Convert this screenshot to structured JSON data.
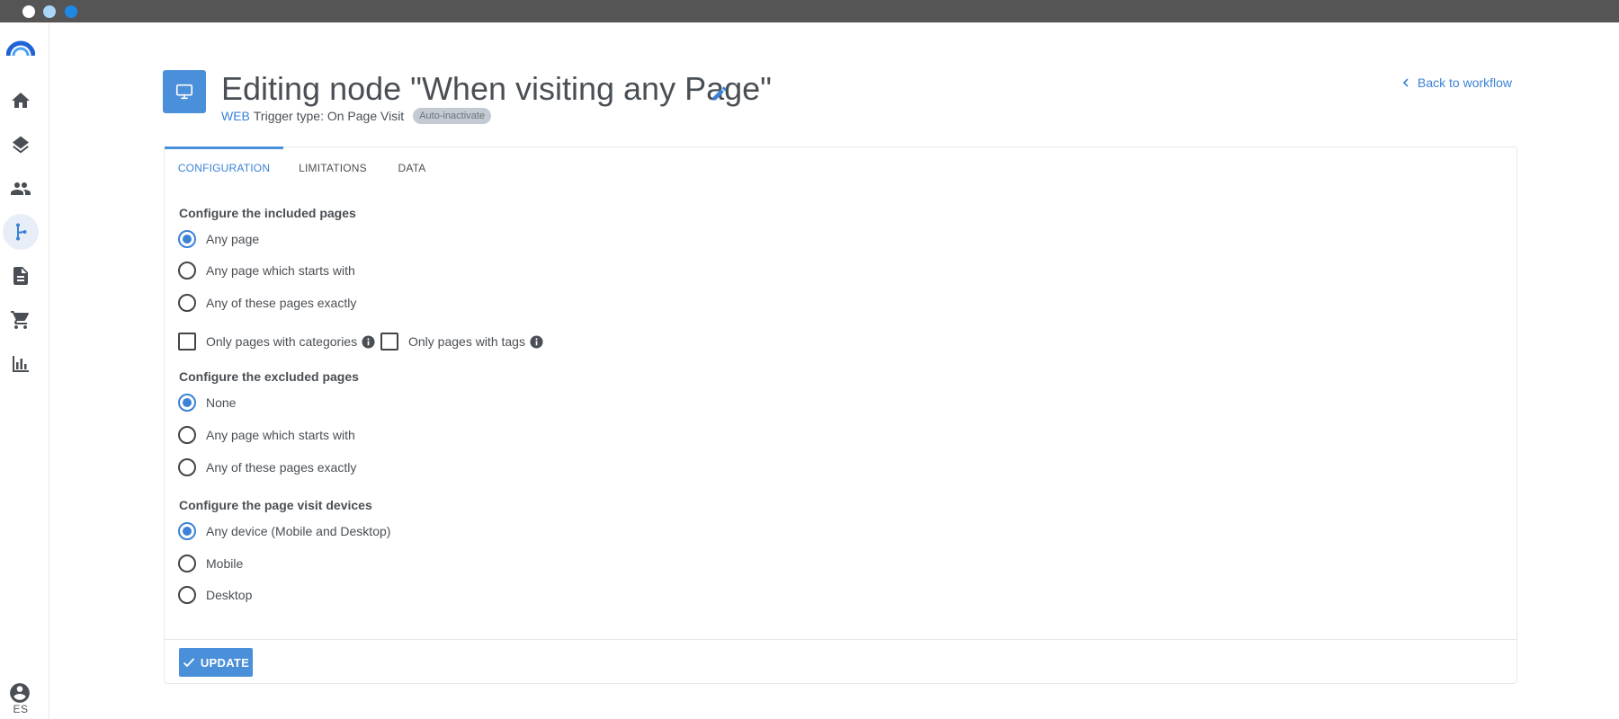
{
  "header": {
    "title": "Editing node \"When visiting any Page\"",
    "channel": "WEB",
    "trigger": "Trigger type: On Page Visit",
    "badge": "Auto-inactivate",
    "back_link": "Back to workflow"
  },
  "sidebar": {
    "items": [
      {
        "icon": "home-icon"
      },
      {
        "icon": "layers-icon"
      },
      {
        "icon": "people-icon"
      },
      {
        "icon": "workflow-icon",
        "active": true
      },
      {
        "icon": "document-icon"
      },
      {
        "icon": "cart-icon"
      },
      {
        "icon": "bar-chart-icon"
      }
    ],
    "language": "ES"
  },
  "tabs": [
    {
      "label": "CONFIGURATION",
      "active": true
    },
    {
      "label": "LIMITATIONS"
    },
    {
      "label": "DATA"
    }
  ],
  "included": {
    "title": "Configure the included pages",
    "options": [
      "Any page",
      "Any page which starts with",
      "Any of these pages exactly"
    ],
    "selected": "Any page",
    "checkboxes": [
      "Only pages with categories",
      "Only pages with tags"
    ]
  },
  "excluded": {
    "title": "Configure the excluded pages",
    "options": [
      "None",
      "Any page which starts with",
      "Any of these pages exactly"
    ],
    "selected": "None"
  },
  "devices": {
    "title": "Configure the page visit devices",
    "options": [
      "Any device (Mobile and Desktop)",
      "Mobile",
      "Desktop"
    ],
    "selected": "Any device (Mobile and Desktop)"
  },
  "update_label": "UPDATE",
  "colors": {
    "accent": "#4a8fd9",
    "titlebar": "#555555",
    "badge_bg": "#c4cad1"
  }
}
